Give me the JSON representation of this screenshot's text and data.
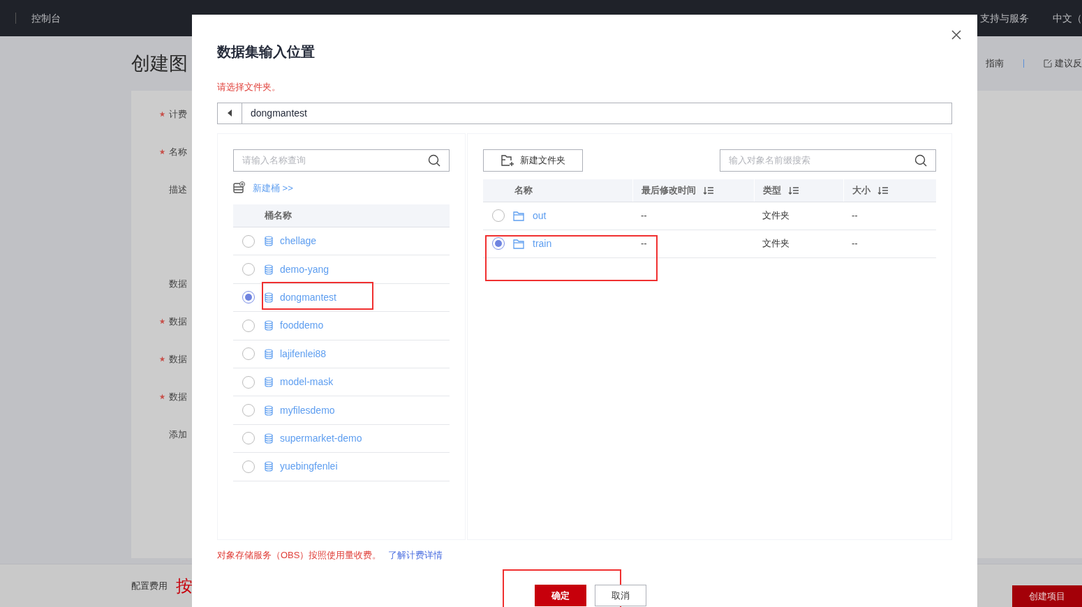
{
  "topbar": {
    "console": "控制台",
    "nav": [
      "支持与服务",
      "中文（"
    ]
  },
  "page": {
    "title": "创建图",
    "links": [
      "指南",
      "建议反"
    ],
    "fields": [
      {
        "label": "计费",
        "required": true,
        "kind": "line"
      },
      {
        "label": "名称",
        "required": true,
        "kind": "line"
      },
      {
        "label": "描述",
        "required": false,
        "kind": "textarea"
      },
      {
        "label": "数据",
        "required": false,
        "kind": "line"
      },
      {
        "label": "数据",
        "required": true,
        "kind": "line"
      },
      {
        "label": "数据",
        "required": true,
        "kind": "line"
      },
      {
        "label": "数据",
        "required": true,
        "kind": "line"
      },
      {
        "label": "添加",
        "required": false,
        "kind": "line"
      }
    ],
    "footer": {
      "label": "配置费用",
      "price": "按",
      "create_button": "创建项目"
    }
  },
  "dialog": {
    "title": "数据集输入位置",
    "hint": "请选择文件夹。",
    "path": "dongmantest",
    "bucket_search": {
      "placeholder": "请输入名称查询"
    },
    "new_bucket": "新建桶 >>",
    "bucket_header": "桶名称",
    "buckets": [
      {
        "name": "chellage",
        "selected": false,
        "highlighted": false
      },
      {
        "name": "demo-yang",
        "selected": false,
        "highlighted": false
      },
      {
        "name": "dongmantest",
        "selected": true,
        "highlighted": true
      },
      {
        "name": "fooddemo",
        "selected": false,
        "highlighted": false
      },
      {
        "name": "lajifenlei88",
        "selected": false,
        "highlighted": false
      },
      {
        "name": "model-mask",
        "selected": false,
        "highlighted": false
      },
      {
        "name": "myfilesdemo",
        "selected": false,
        "highlighted": false
      },
      {
        "name": "supermarket-demo",
        "selected": false,
        "highlighted": false
      },
      {
        "name": "yuebingfenlei",
        "selected": false,
        "highlighted": false
      }
    ],
    "new_folder": "新建文件夹",
    "object_search": {
      "placeholder": "输入对象名前缀搜索"
    },
    "columns": [
      {
        "label": "名称",
        "sortable": false
      },
      {
        "label": "最后修改时间",
        "sortable": true
      },
      {
        "label": "类型",
        "sortable": true
      },
      {
        "label": "大小",
        "sortable": true
      }
    ],
    "rows": [
      {
        "name": "out",
        "modified": "--",
        "type": "文件夹",
        "size": "--",
        "selected": false,
        "highlighted": false
      },
      {
        "name": "train",
        "modified": "--",
        "type": "文件夹",
        "size": "--",
        "selected": true,
        "highlighted": true
      }
    ],
    "note": "对象存储服务（OBS）按照使用量收费。",
    "note_link": "了解计费详情",
    "buttons": [
      {
        "label": "确定",
        "kind": "primary",
        "highlighted": true
      },
      {
        "label": "取消",
        "kind": "secondary",
        "highlighted": false
      }
    ]
  }
}
